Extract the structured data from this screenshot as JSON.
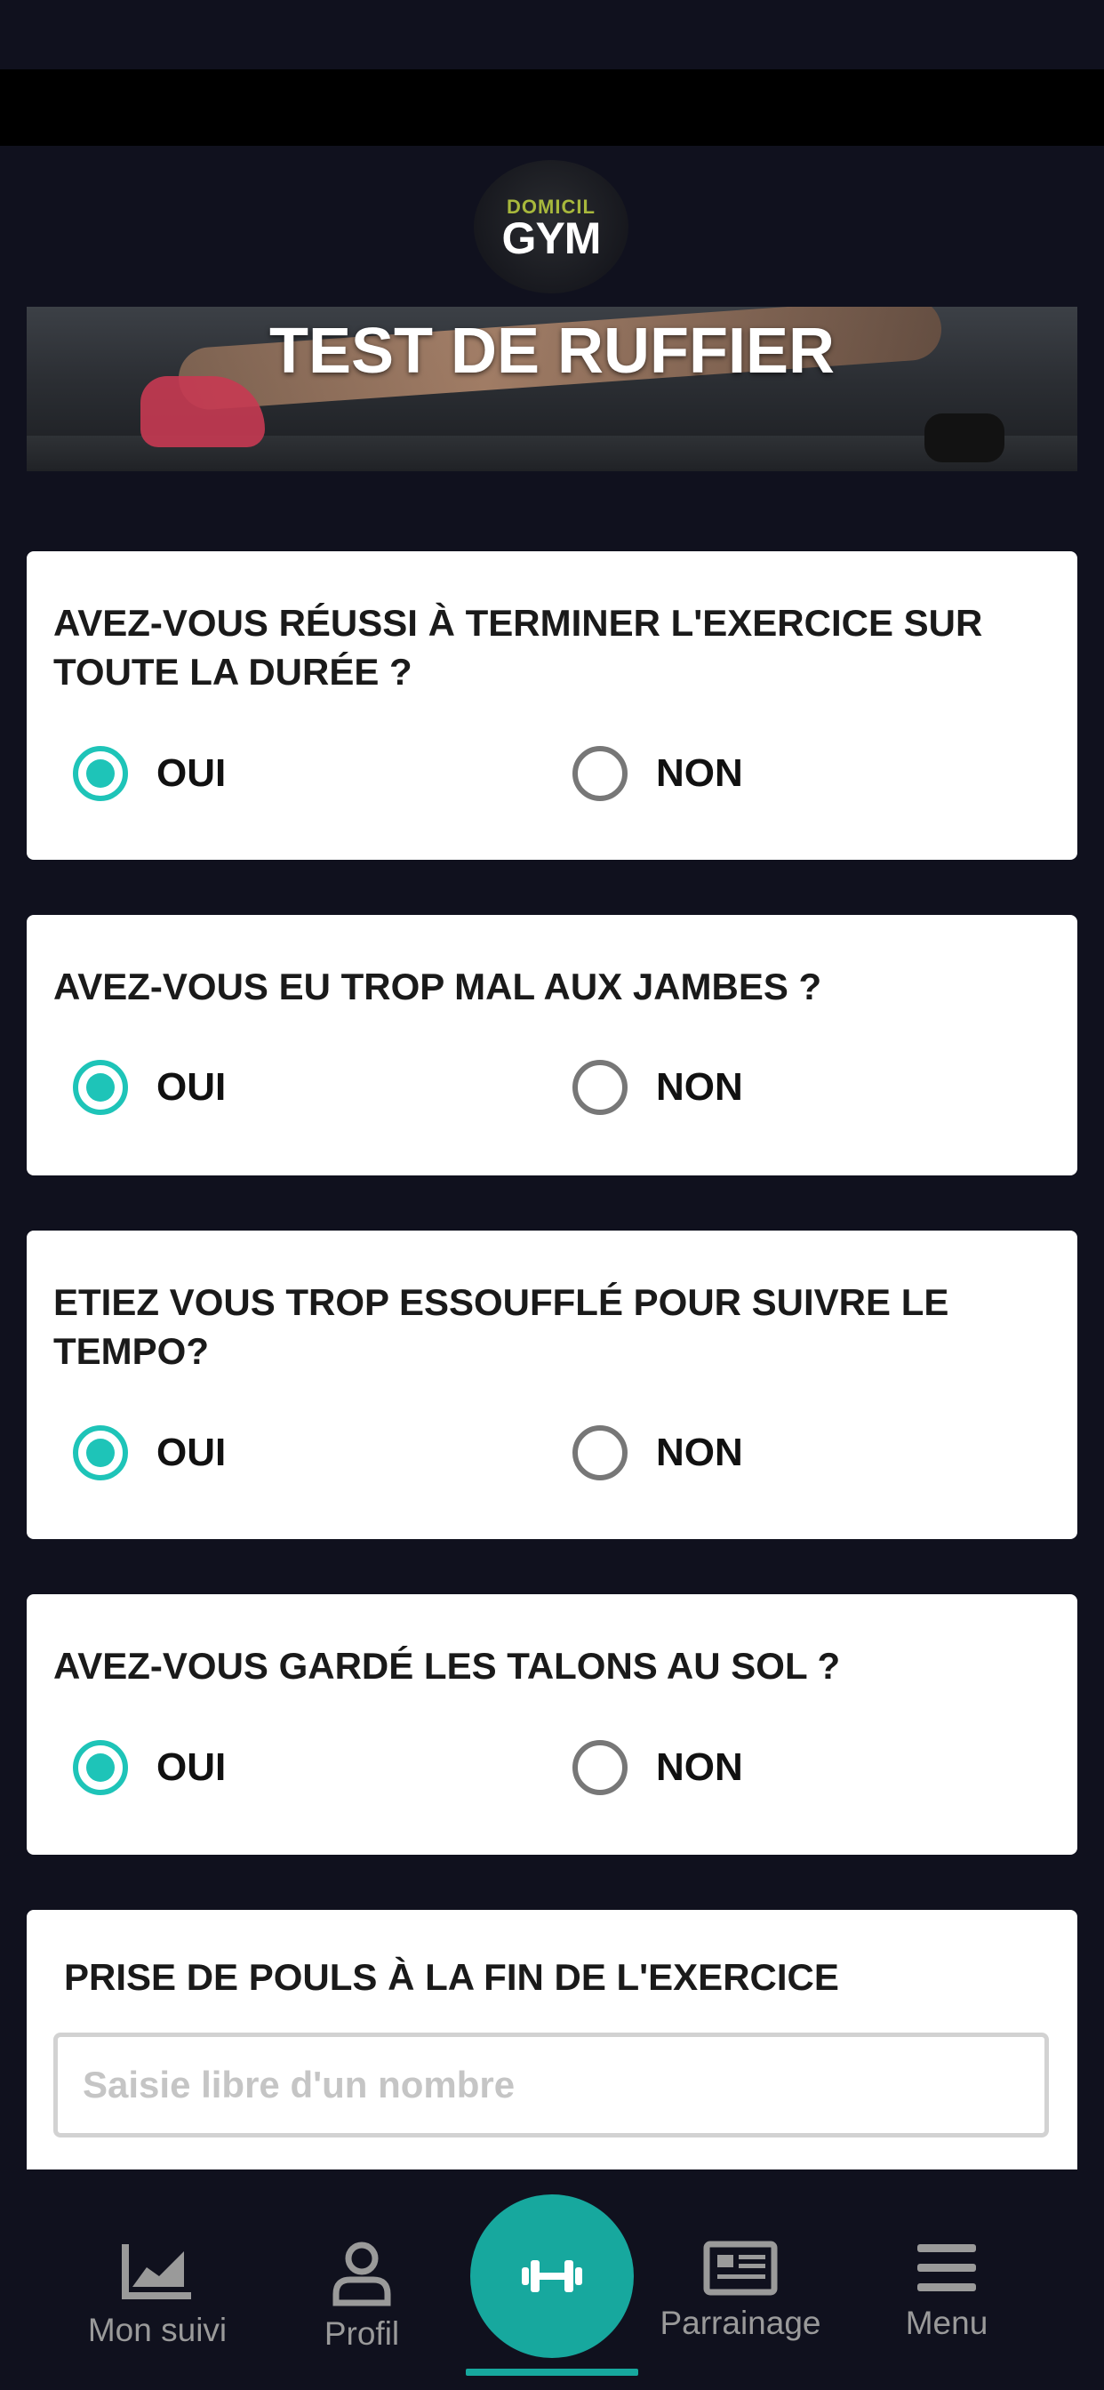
{
  "logo": {
    "top": "DOMICIL",
    "bottom": "GYM"
  },
  "hero": {
    "title": "TEST DE RUFFIER"
  },
  "questions": [
    {
      "text": "AVEZ-VOUS RÉUSSI À TERMINER L'EXERCICE SUR TOUTE LA DURÉE ?",
      "options": [
        "OUI",
        "NON"
      ],
      "selected": "OUI"
    },
    {
      "text": "AVEZ-VOUS EU TROP MAL AUX JAMBES ?",
      "options": [
        "OUI",
        "NON"
      ],
      "selected": "OUI"
    },
    {
      "text": "ETIEZ VOUS TROP ESSOUFFLÉ POUR SUIVRE LE TEMPO?",
      "options": [
        "OUI",
        "NON"
      ],
      "selected": "OUI"
    },
    {
      "text": "AVEZ-VOUS GARDÉ LES TALONS AU SOL ?",
      "options": [
        "OUI",
        "NON"
      ],
      "selected": "OUI"
    }
  ],
  "pulse": {
    "label": "PRISE DE POULS À LA FIN DE L'EXERCICE",
    "placeholder": "Saisie libre d'un nombre",
    "value": ""
  },
  "nav": {
    "items": [
      {
        "label": "Mon suivi",
        "icon": "chart-line-icon"
      },
      {
        "label": "Profil",
        "icon": "user-icon"
      },
      {
        "label": "",
        "icon": "dumbbell-icon",
        "active": true
      },
      {
        "label": "Parrainage",
        "icon": "newspaper-icon"
      },
      {
        "label": "Menu",
        "icon": "hamburger-menu-icon"
      }
    ]
  },
  "colors": {
    "accent": "#1ec4b8",
    "background": "#10111e",
    "card": "#ffffff"
  }
}
